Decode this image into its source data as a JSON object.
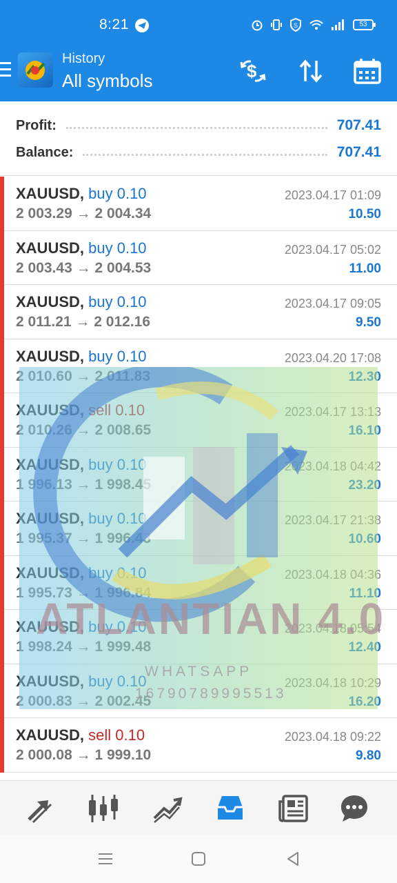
{
  "status_bar": {
    "time": "8:21",
    "battery": "53"
  },
  "app_bar": {
    "subtitle": "History",
    "title": "All symbols"
  },
  "summary": {
    "profit_label": "Profit:",
    "profit_value": "707.41",
    "balance_label": "Balance:",
    "balance_value": "707.41"
  },
  "trades": [
    {
      "symbol": "XAUUSD,",
      "side": "buy 0.10",
      "type": "buy",
      "open": "2 003.29",
      "close": "2 004.34",
      "date": "2023.04.17 01:09",
      "profit": "10.50"
    },
    {
      "symbol": "XAUUSD,",
      "side": "buy 0.10",
      "type": "buy",
      "open": "2 003.43",
      "close": "2 004.53",
      "date": "2023.04.17 05:02",
      "profit": "11.00"
    },
    {
      "symbol": "XAUUSD,",
      "side": "buy 0.10",
      "type": "buy",
      "open": "2 011.21",
      "close": "2 012.16",
      "date": "2023.04.17 09:05",
      "profit": "9.50"
    },
    {
      "symbol": "XAUUSD,",
      "side": "buy 0.10",
      "type": "buy",
      "open": "2 010.60",
      "close": "2 011.83",
      "date": "2023.04.20 17:08",
      "profit": "12.30"
    },
    {
      "symbol": "XAUUSD,",
      "side": "sell 0.10",
      "type": "sell",
      "open": "2 010.26",
      "close": "2 008.65",
      "date": "2023.04.17 13:13",
      "profit": "16.10"
    },
    {
      "symbol": "XAUUSD,",
      "side": "buy 0.10",
      "type": "buy",
      "open": "1 996.13",
      "close": "1 998.45",
      "date": "2023.04.18 04:42",
      "profit": "23.20"
    },
    {
      "symbol": "XAUUSD,",
      "side": "buy 0.10",
      "type": "buy",
      "open": "1 995.37",
      "close": "1 996.43",
      "date": "2023.04.17 21:38",
      "profit": "10.60"
    },
    {
      "symbol": "XAUUSD,",
      "side": "buy 0.10",
      "type": "buy",
      "open": "1 995.73",
      "close": "1 996.84",
      "date": "2023.04.18 04:36",
      "profit": "11.10"
    },
    {
      "symbol": "XAUUSD,",
      "side": "buy 0.10",
      "type": "buy",
      "open": "1 998.24",
      "close": "1 999.48",
      "date": "2023.04.18 05:54",
      "profit": "12.40"
    },
    {
      "symbol": "XAUUSD,",
      "side": "buy 0.10",
      "type": "buy",
      "open": "2 000.83",
      "close": "2 002.45",
      "date": "2023.04.18 10:29",
      "profit": "16.20"
    },
    {
      "symbol": "XAUUSD,",
      "side": "sell 0.10",
      "type": "sell",
      "open": "2 000.08",
      "close": "1 999.10",
      "date": "2023.04.18 09:22",
      "profit": "9.80"
    }
  ],
  "arrow": "→",
  "watermark": {
    "brand": "ATLANTIAN 4.0",
    "channel": "WHATSAPP",
    "phone": "16790789995513"
  },
  "colors": {
    "accent": "#1e88e5",
    "buy": "#1976d2",
    "sell": "#c62828",
    "position_bar": "#e53935"
  },
  "bottom_nav": [
    "trade-icon",
    "quotes-icon",
    "chart-icon",
    "history-icon",
    "news-icon",
    "chat-icon"
  ],
  "active_nav": "history-icon"
}
